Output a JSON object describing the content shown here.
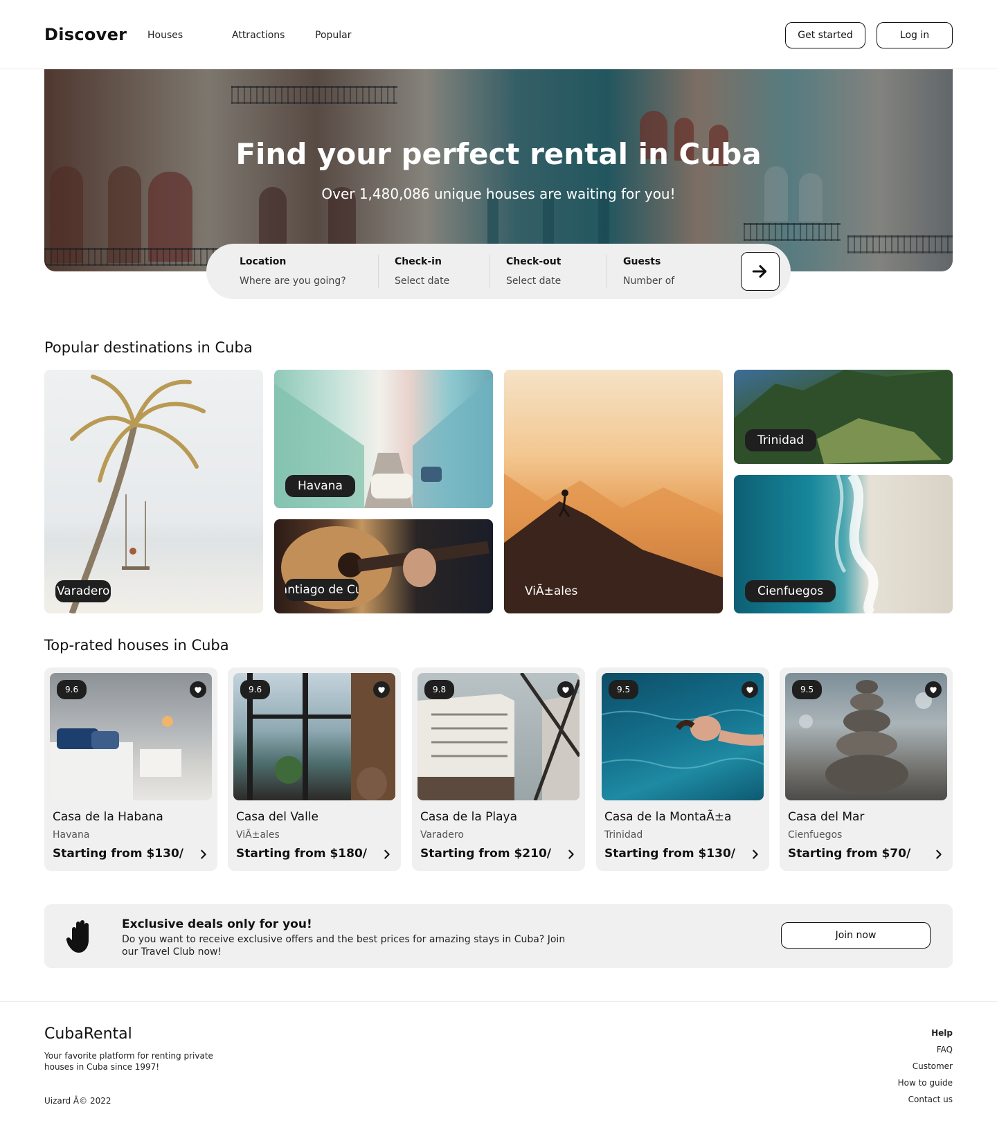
{
  "header": {
    "logo": "Discover",
    "nav": [
      "Houses",
      "Attractions",
      "Popular"
    ],
    "get_started": "Get started",
    "login": "Log in"
  },
  "hero": {
    "title": "Find your perfect rental in Cuba",
    "subtitle": "Over 1,480,086 unique houses are waiting for you!"
  },
  "search": {
    "fields": [
      {
        "label": "Location",
        "value": "Where are you going?"
      },
      {
        "label": "Check-in",
        "value": "Select date"
      },
      {
        "label": "Check-out",
        "value": "Select date"
      },
      {
        "label": "Guests",
        "value": "Number of"
      }
    ],
    "submit_icon": "arrow-right-icon"
  },
  "destinations": {
    "title": "Popular destinations in Cuba",
    "items": [
      "Varadero",
      "Havana",
      "Santiago de Cuba",
      "ViÃ±ales",
      "Trinidad",
      "Cienfuegos"
    ]
  },
  "houses": {
    "title": "Top-rated houses in Cuba",
    "items": [
      {
        "rating": "9.6",
        "name": "Casa de la Habana",
        "city": "Havana",
        "price": "Starting from $130/"
      },
      {
        "rating": "9.6",
        "name": "Casa del Valle",
        "city": "ViÃ±ales",
        "price": "Starting from $180/"
      },
      {
        "rating": "9.8",
        "name": "Casa de la Playa",
        "city": "Varadero",
        "price": "Starting from $210/"
      },
      {
        "rating": "9.5",
        "name": "Casa de la MontaÃ±a",
        "city": "Trinidad",
        "price": "Starting from $130/"
      },
      {
        "rating": "9.5",
        "name": "Casa del Mar",
        "city": "Cienfuegos",
        "price": "Starting from $70/"
      }
    ]
  },
  "promo": {
    "icon": "hand-icon",
    "title": "Exclusive deals only for you!",
    "text": "Do you want to receive exclusive offers and the best prices for amazing stays in Cuba? Join our Travel Club now!",
    "button": "Join now"
  },
  "footer": {
    "brand": "CubaRental",
    "tagline": "Your favorite platform for renting private houses in Cuba since 1997!",
    "copyright": "Uizard Â© 2022",
    "links": [
      "Help",
      "FAQ",
      "Customer",
      "How to guide",
      "Contact us"
    ]
  },
  "colors": {
    "accent": "#111111",
    "card_bg": "#f0f0f0",
    "badge_bg": "#1f1f1f",
    "border": "#ececec"
  }
}
